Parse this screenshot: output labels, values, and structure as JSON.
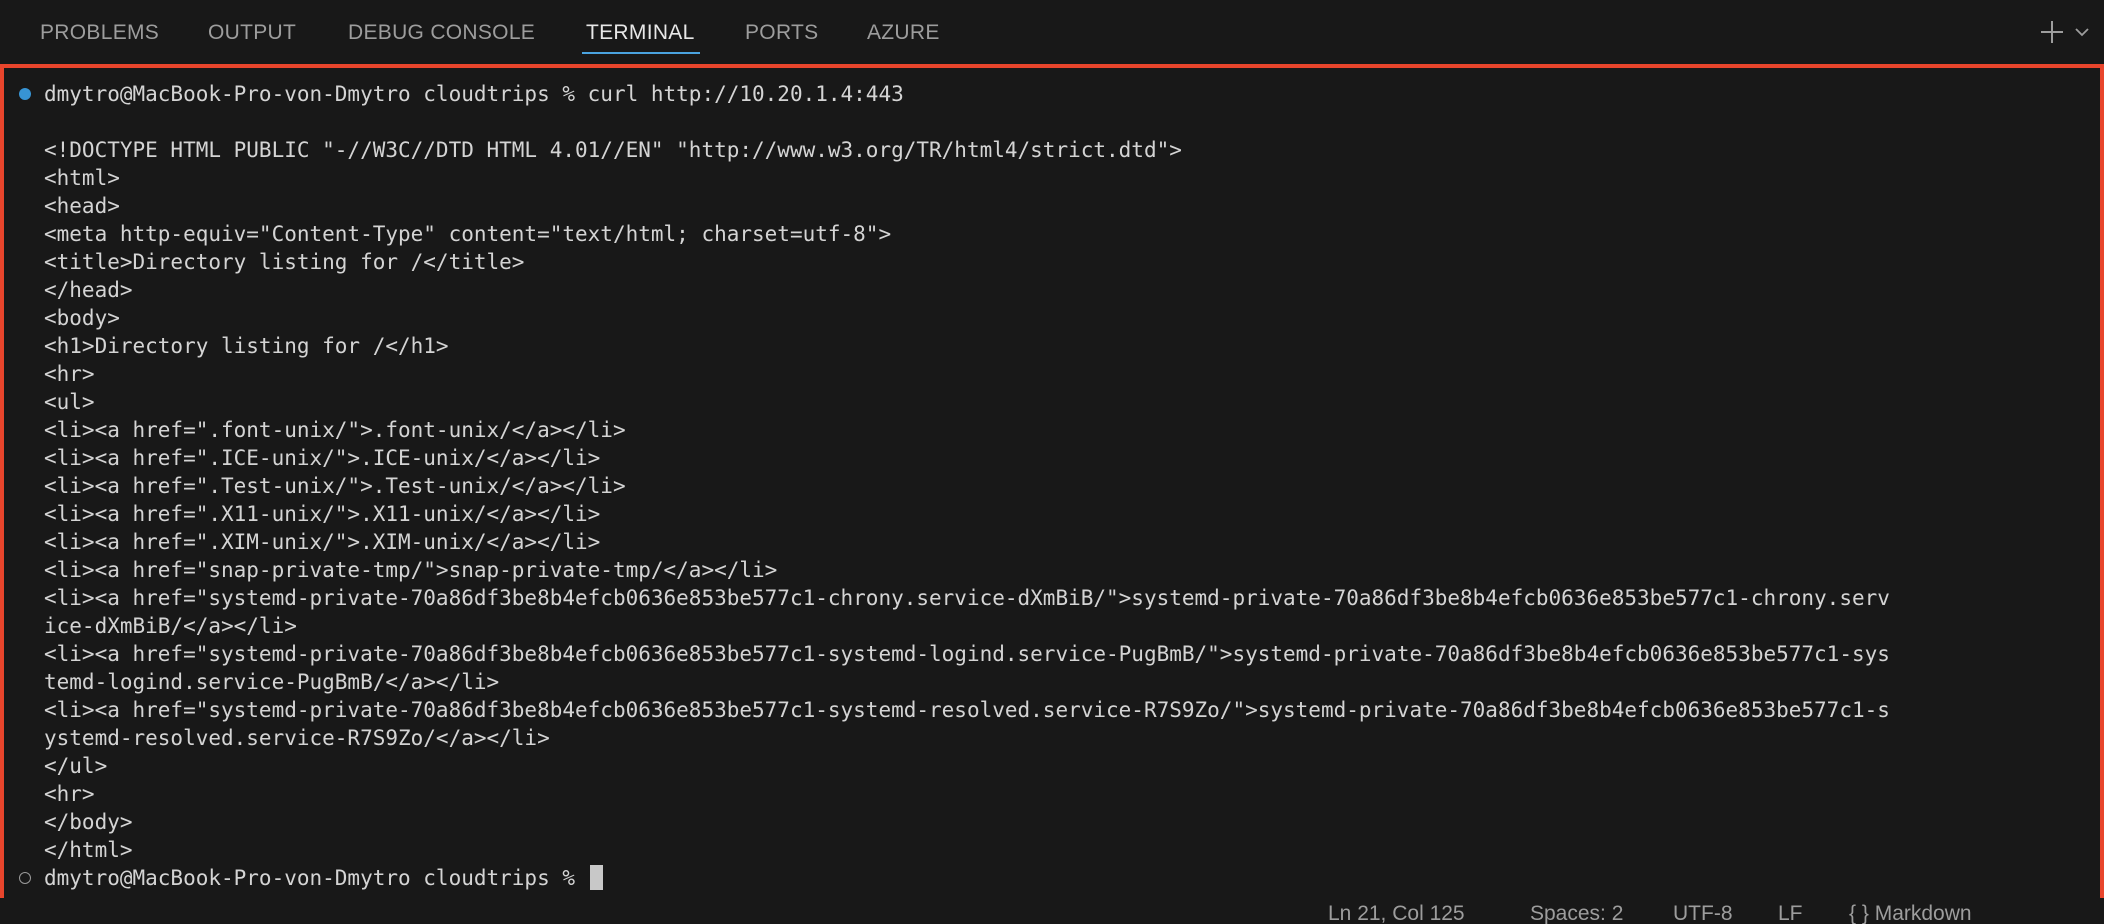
{
  "panel": {
    "tabs": [
      {
        "label": "PROBLEMS"
      },
      {
        "label": "OUTPUT"
      },
      {
        "label": "DEBUG CONSOLE"
      },
      {
        "label": "TERMINAL"
      },
      {
        "label": "PORTS"
      },
      {
        "label": "AZURE"
      }
    ],
    "active_tab": "TERMINAL"
  },
  "terminal": {
    "lines": [
      "dmytro@MacBook-Pro-von-Dmytro cloudtrips % curl http://10.20.1.4:443",
      "",
      "<!DOCTYPE HTML PUBLIC \"-//W3C//DTD HTML 4.01//EN\" \"http://www.w3.org/TR/html4/strict.dtd\">",
      "<html>",
      "<head>",
      "<meta http-equiv=\"Content-Type\" content=\"text/html; charset=utf-8\">",
      "<title>Directory listing for /</title>",
      "</head>",
      "<body>",
      "<h1>Directory listing for /</h1>",
      "<hr>",
      "<ul>",
      "<li><a href=\".font-unix/\">.font-unix/</a></li>",
      "<li><a href=\".ICE-unix/\">.ICE-unix/</a></li>",
      "<li><a href=\".Test-unix/\">.Test-unix/</a></li>",
      "<li><a href=\".X11-unix/\">.X11-unix/</a></li>",
      "<li><a href=\".XIM-unix/\">.XIM-unix/</a></li>",
      "<li><a href=\"snap-private-tmp/\">snap-private-tmp/</a></li>",
      "<li><a href=\"systemd-private-70a86df3be8b4efcb0636e853be577c1-chrony.service-dXmBiB/\">systemd-private-70a86df3be8b4efcb0636e853be577c1-chrony.serv",
      "ice-dXmBiB/</a></li>",
      "<li><a href=\"systemd-private-70a86df3be8b4efcb0636e853be577c1-systemd-logind.service-PugBmB/\">systemd-private-70a86df3be8b4efcb0636e853be577c1-sys",
      "temd-logind.service-PugBmB/</a></li>",
      "<li><a href=\"systemd-private-70a86df3be8b4efcb0636e853be577c1-systemd-resolved.service-R7S9Zo/\">systemd-private-70a86df3be8b4efcb0636e853be577c1-s",
      "ystemd-resolved.service-R7S9Zo/</a></li>",
      "</ul>",
      "<hr>",
      "</body>",
      "</html>",
      "dmytro@MacBook-Pro-von-Dmytro cloudtrips % "
    ]
  },
  "status_bar": {
    "items": [
      {
        "label": "Ln 21, Col 125"
      },
      {
        "label": "Spaces: 2"
      },
      {
        "label": "UTF-8"
      },
      {
        "label": "LF"
      },
      {
        "label": "{ } Markdown"
      }
    ]
  },
  "colors": {
    "background": "#181818",
    "highlight_border": "#e8452c",
    "active_tab_underline": "#4aa3df",
    "text": "#d4d4d4"
  }
}
